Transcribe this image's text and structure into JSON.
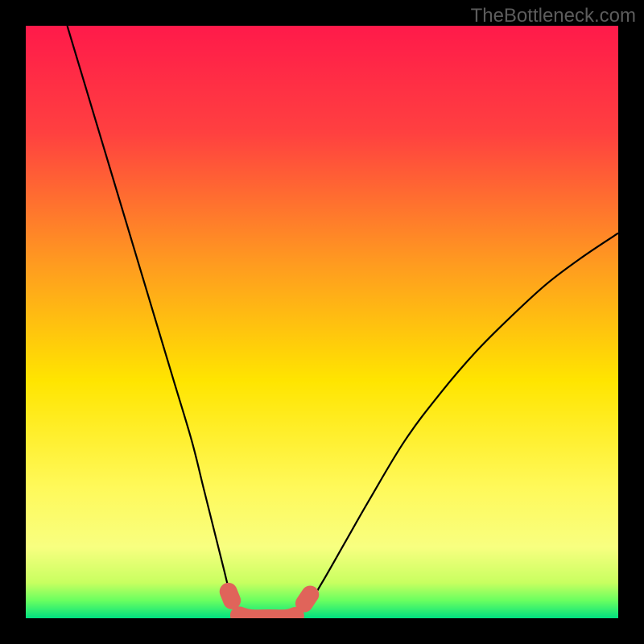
{
  "watermark": "TheBottleneck.com",
  "chart_data": {
    "type": "line",
    "title": "",
    "xlabel": "",
    "ylabel": "",
    "xlim": [
      0,
      100
    ],
    "ylim": [
      0,
      100
    ],
    "gradient_stops": [
      {
        "offset": 0.0,
        "color": "#ff1a4a"
      },
      {
        "offset": 0.18,
        "color": "#ff4040"
      },
      {
        "offset": 0.4,
        "color": "#ff9a20"
      },
      {
        "offset": 0.6,
        "color": "#ffe500"
      },
      {
        "offset": 0.78,
        "color": "#fff95a"
      },
      {
        "offset": 0.88,
        "color": "#f8ff80"
      },
      {
        "offset": 0.94,
        "color": "#c8ff60"
      },
      {
        "offset": 0.97,
        "color": "#6aff60"
      },
      {
        "offset": 1.0,
        "color": "#00e080"
      }
    ],
    "series": [
      {
        "name": "left-branch",
        "stroke": "#000000",
        "stroke_width": 2.2,
        "points": [
          {
            "x": 7.0,
            "y": 100.0
          },
          {
            "x": 10.0,
            "y": 90.0
          },
          {
            "x": 13.0,
            "y": 80.0
          },
          {
            "x": 16.0,
            "y": 70.0
          },
          {
            "x": 19.0,
            "y": 60.0
          },
          {
            "x": 22.0,
            "y": 50.0
          },
          {
            "x": 25.0,
            "y": 40.0
          },
          {
            "x": 28.0,
            "y": 30.0
          },
          {
            "x": 30.0,
            "y": 22.0
          },
          {
            "x": 32.0,
            "y": 14.0
          },
          {
            "x": 33.5,
            "y": 8.0
          },
          {
            "x": 34.5,
            "y": 4.0
          },
          {
            "x": 35.5,
            "y": 1.5
          },
          {
            "x": 37.0,
            "y": 0.2
          },
          {
            "x": 38.0,
            "y": 0.0
          }
        ]
      },
      {
        "name": "right-branch",
        "stroke": "#000000",
        "stroke_width": 2.2,
        "points": [
          {
            "x": 44.0,
            "y": 0.0
          },
          {
            "x": 45.5,
            "y": 0.3
          },
          {
            "x": 47.5,
            "y": 2.0
          },
          {
            "x": 50.0,
            "y": 6.0
          },
          {
            "x": 54.0,
            "y": 13.0
          },
          {
            "x": 58.0,
            "y": 20.0
          },
          {
            "x": 64.0,
            "y": 30.0
          },
          {
            "x": 70.0,
            "y": 38.0
          },
          {
            "x": 76.0,
            "y": 45.0
          },
          {
            "x": 82.0,
            "y": 51.0
          },
          {
            "x": 88.0,
            "y": 56.5
          },
          {
            "x": 94.0,
            "y": 61.0
          },
          {
            "x": 100.0,
            "y": 65.0
          }
        ]
      },
      {
        "name": "flat-bottom-band",
        "stroke": "#e0645a",
        "stroke_width": 22.0,
        "linecap": "round",
        "points": [
          {
            "x": 36.0,
            "y": 0.5
          },
          {
            "x": 38.0,
            "y": 0.0
          },
          {
            "x": 41.0,
            "y": 0.0
          },
          {
            "x": 44.0,
            "y": 0.0
          },
          {
            "x": 45.5,
            "y": 0.4
          }
        ]
      },
      {
        "name": "flat-bottom-band-left-dot",
        "stroke": "#e0645a",
        "stroke_width": 22.0,
        "linecap": "round",
        "points": [
          {
            "x": 34.2,
            "y": 4.5
          },
          {
            "x": 34.8,
            "y": 3.0
          }
        ]
      },
      {
        "name": "flat-bottom-band-right-dot",
        "stroke": "#e0645a",
        "stroke_width": 22.0,
        "linecap": "round",
        "points": [
          {
            "x": 47.0,
            "y": 2.5
          },
          {
            "x": 48.0,
            "y": 4.0
          }
        ]
      }
    ]
  }
}
